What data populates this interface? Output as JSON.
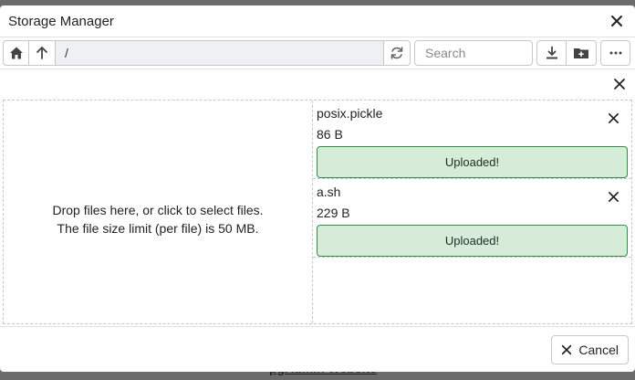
{
  "backdrop": {
    "link_text": "pgAdmin Website"
  },
  "dialog": {
    "title": "Storage Manager"
  },
  "toolbar": {
    "path": "/",
    "search_placeholder": "Search"
  },
  "upload": {
    "dropzone_line1": "Drop files here, or click to select files.",
    "dropzone_line2": "The file size limit (per file) is 50 MB.",
    "files": [
      {
        "name": "posix.pickle",
        "size": "86 B",
        "status": "Uploaded!"
      },
      {
        "name": "a.sh",
        "size": "229 B",
        "status": "Uploaded!"
      }
    ]
  },
  "footer": {
    "cancel_label": "Cancel"
  },
  "colors": {
    "status_bg": "#d6ecd9",
    "status_border": "#2d8f46",
    "path_bg": "#eef0f4"
  },
  "icons": {
    "close": "close-icon",
    "home": "home-icon",
    "up": "arrow-up-icon",
    "refresh": "refresh-icon",
    "download": "download-icon",
    "new_folder": "new-folder-icon",
    "more": "more-icon"
  }
}
